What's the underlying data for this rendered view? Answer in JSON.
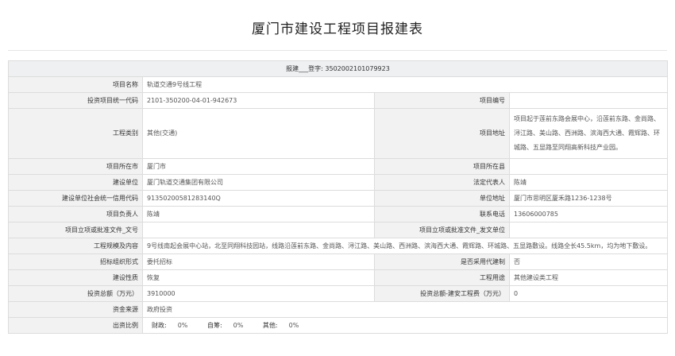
{
  "page": {
    "title": "厦门市建设工程项目报建表"
  },
  "table": {
    "header": "报建___登字: 3502002101079923",
    "rows": {
      "project_name": {
        "label": "项目名称",
        "value": "轨道交通9号线工程"
      },
      "invest_code": {
        "label": "投资项目统一代码",
        "value": "2101-350200-04-01-942673"
      },
      "project_no": {
        "label": "项目编号",
        "value": ""
      },
      "category": {
        "label": "工程类别",
        "value": "其他(交通)"
      },
      "address": {
        "label": "项目地址",
        "value": "项目起于莲前东路会展中心，沿莲前东路、金尚路、浔江路、美山路、西洲路、滨海西大通、霞辉路、环城路、五显路至同翔高新科技产业园。"
      },
      "city": {
        "label": "项目所在市",
        "value": "厦门市"
      },
      "county": {
        "label": "项目所在县",
        "value": ""
      },
      "builder": {
        "label": "建设单位",
        "value": "厦门轨道交通集团有限公司"
      },
      "legal_rep": {
        "label": "法定代表人",
        "value": "陈靖"
      },
      "credit_code": {
        "label": "建设单位社会统一信用代码",
        "value": "91350200581283140Q"
      },
      "unit_address": {
        "label": "单位地址",
        "value": "厦门市思明区厦禾路1236-1238号"
      },
      "project_lead": {
        "label": "项目负责人",
        "value": "陈靖"
      },
      "phone": {
        "label": "联系电话",
        "value": "13606000785"
      },
      "approval_doc": {
        "label": "项目立项或批准文件_文号",
        "value": ""
      },
      "approval_unit": {
        "label": "项目立项或批准文件_发文单位",
        "value": ""
      },
      "scale": {
        "label": "工程规模及内容",
        "value": "9号线南起会展中心站，北至同翔科技园站，线路沿莲前东路、金尚路、浔江路、美山路、西洲路、滨海西大通、霞辉路、环城路、五显路敷设。线路全长45.5km，均为地下敷设。"
      },
      "tender_form": {
        "label": "招标组织形式",
        "value": "委托招标"
      },
      "agent_build": {
        "label": "是否采用代建制",
        "value": "否"
      },
      "nature": {
        "label": "建设性质",
        "value": "恢复"
      },
      "usage": {
        "label": "工程用途",
        "value": "其他建设类工程"
      },
      "total_invest": {
        "label": "投资总额（万元）",
        "value": "3910000"
      },
      "install_cost": {
        "label": "投资总额-建安工程费（万元）",
        "value": "0"
      },
      "funding": {
        "label": "资金来源",
        "value": "政府投资"
      },
      "ratio": {
        "label": "出资比例",
        "fiscal_label": "财政:",
        "fiscal_value": "0%",
        "self_label": "自筹:",
        "self_value": "0%",
        "other_label": "其他:",
        "other_value": "0%"
      }
    }
  }
}
